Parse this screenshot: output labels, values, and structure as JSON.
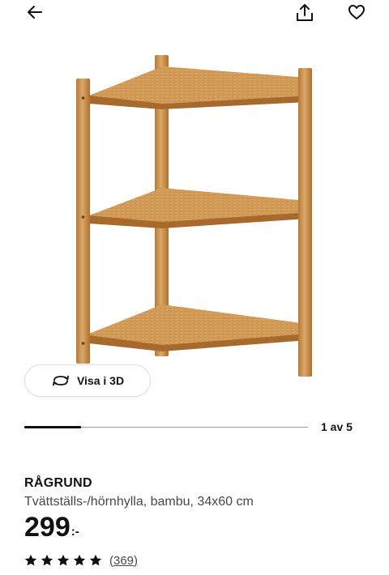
{
  "header": {
    "back_icon": "arrow-left-icon",
    "share_icon": "share-icon",
    "favorite_icon": "heart-icon"
  },
  "gallery": {
    "view_3d_label": "Visa i 3D",
    "view_3d_icon": "rotate-3d-icon",
    "pager_text": "1 av 5",
    "current_index": 1,
    "total_images": 5
  },
  "product": {
    "name": "RÅGRUND",
    "description": "Tvättställs-/hörnhylla, bambu, 34x60 cm",
    "price_integer": "299",
    "price_suffix": ":-",
    "rating_stars": 5,
    "review_count": "(369)"
  },
  "colors": {
    "text_primary": "#111111",
    "text_secondary": "#484848",
    "bamboo_light": "#d9a562",
    "bamboo_mid": "#c98a44",
    "bamboo_dark": "#a8692d"
  }
}
